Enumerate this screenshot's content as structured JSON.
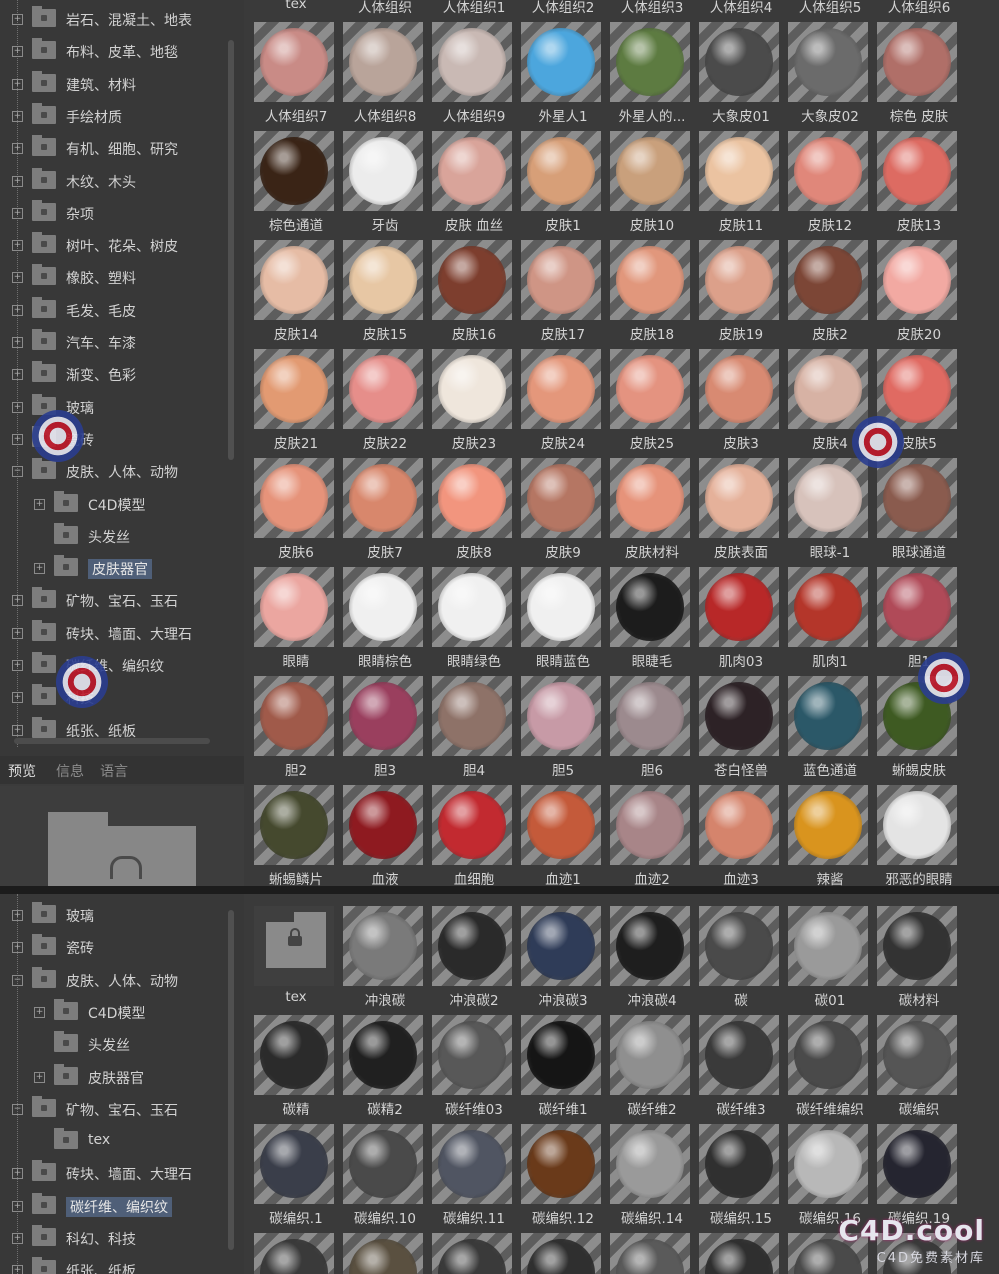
{
  "top": {
    "tree": [
      {
        "label": "岩石、混凝土、地表",
        "type": "folder",
        "expand": "plus",
        "depth": 0
      },
      {
        "label": "布料、皮革、地毯",
        "type": "folder",
        "expand": "plus",
        "depth": 0
      },
      {
        "label": "建筑、材料",
        "type": "folder",
        "expand": "plus",
        "depth": 0
      },
      {
        "label": "手绘材质",
        "type": "folder",
        "expand": "plus",
        "depth": 0
      },
      {
        "label": "有机、细胞、研究",
        "type": "folder",
        "expand": "plus",
        "depth": 0
      },
      {
        "label": "木纹、木头",
        "type": "folder",
        "expand": "plus",
        "depth": 0
      },
      {
        "label": "杂项",
        "type": "folder",
        "expand": "plus",
        "depth": 0
      },
      {
        "label": "树叶、花朵、树皮",
        "type": "folder",
        "expand": "plus",
        "depth": 0
      },
      {
        "label": "橡胶、塑料",
        "type": "folder",
        "expand": "plus",
        "depth": 0
      },
      {
        "label": "毛发、毛皮",
        "type": "folder",
        "expand": "plus",
        "depth": 0
      },
      {
        "label": "汽车、车漆",
        "type": "folder",
        "expand": "plus",
        "depth": 0
      },
      {
        "label": "渐变、色彩",
        "type": "folder",
        "expand": "plus",
        "depth": 0
      },
      {
        "label": "玻璃",
        "type": "folder",
        "expand": "plus",
        "depth": 0
      },
      {
        "label": "瓷砖",
        "type": "folder",
        "expand": "plus",
        "depth": 0
      },
      {
        "label": "皮肤、人体、动物",
        "type": "folder",
        "expand": "minus",
        "depth": 0
      },
      {
        "label": "C4D模型",
        "type": "folder",
        "expand": "plus",
        "depth": 1
      },
      {
        "label": "头发丝",
        "type": "folder",
        "expand": "none",
        "depth": 1
      },
      {
        "label": "皮肤器官",
        "type": "folder",
        "expand": "plus",
        "depth": 1,
        "selected": true
      },
      {
        "label": "矿物、宝石、玉石",
        "type": "folder",
        "expand": "plus",
        "depth": 0
      },
      {
        "label": "砖块、墙面、大理石",
        "type": "folder",
        "expand": "plus",
        "depth": 0
      },
      {
        "label": "碳纤维、编织纹",
        "type": "folder",
        "expand": "plus",
        "depth": 0
      },
      {
        "label": "科技",
        "type": "folder",
        "expand": "plus",
        "depth": 0
      },
      {
        "label": "纸张、纸板",
        "type": "folder",
        "expand": "plus",
        "depth": 0
      }
    ],
    "tabs": [
      "预览",
      "信息",
      "语言"
    ],
    "header_captions": [
      "tex",
      "人体组织",
      "人体组织1",
      "人体组织2",
      "人体组织3",
      "人体组织4",
      "人体组织5",
      "人体组织6"
    ],
    "materials": [
      {
        "name": "人体组织7",
        "c": "#c98b86"
      },
      {
        "name": "人体组织8",
        "c": "#b9a49a"
      },
      {
        "name": "人体组织9",
        "c": "#c9b9b4"
      },
      {
        "name": "外星人1",
        "c": "#4ca6dd"
      },
      {
        "name": "外星人的...",
        "c": "#5d7b41"
      },
      {
        "name": "大象皮01",
        "c": "#4b4b4b"
      },
      {
        "name": "大象皮02",
        "c": "#6b6b6b"
      },
      {
        "name": "棕色 皮肤",
        "c": "#b06f68"
      },
      {
        "name": "棕色通道",
        "c": "#3a2416"
      },
      {
        "name": "牙齿",
        "c": "#ececec"
      },
      {
        "name": "皮肤 血丝",
        "c": "#d9a49a"
      },
      {
        "name": "皮肤1",
        "c": "#d79f78"
      },
      {
        "name": "皮肤10",
        "c": "#c9a07c"
      },
      {
        "name": "皮肤11",
        "c": "#ebc3a1"
      },
      {
        "name": "皮肤12",
        "c": "#e0877a"
      },
      {
        "name": "皮肤13",
        "c": "#dd6b62"
      },
      {
        "name": "皮肤14",
        "c": "#e6bca5"
      },
      {
        "name": "皮肤15",
        "c": "#e7c7a4"
      },
      {
        "name": "皮肤16",
        "c": "#7d3e2e"
      },
      {
        "name": "皮肤17",
        "c": "#cf9585"
      },
      {
        "name": "皮肤18",
        "c": "#e1977c"
      },
      {
        "name": "皮肤19",
        "c": "#dca08a"
      },
      {
        "name": "皮肤2",
        "c": "#7c4636"
      },
      {
        "name": "皮肤20",
        "c": "#f2a9a2"
      },
      {
        "name": "皮肤21",
        "c": "#e29a72"
      },
      {
        "name": "皮肤22",
        "c": "#e68e8a"
      },
      {
        "name": "皮肤23",
        "c": "#efe6dc"
      },
      {
        "name": "皮肤24",
        "c": "#e4977b"
      },
      {
        "name": "皮肤25",
        "c": "#e49380"
      },
      {
        "name": "皮肤3",
        "c": "#d88a72"
      },
      {
        "name": "皮肤4",
        "c": "#d7b2a4"
      },
      {
        "name": "皮肤5",
        "c": "#e06a62"
      },
      {
        "name": "皮肤6",
        "c": "#e6937a"
      },
      {
        "name": "皮肤7",
        "c": "#d8876c"
      },
      {
        "name": "皮肤8",
        "c": "#f2957e"
      },
      {
        "name": "皮肤9",
        "c": "#b57663"
      },
      {
        "name": "皮肤材料",
        "c": "#e6937a"
      },
      {
        "name": "皮肤表面",
        "c": "#e5b19a"
      },
      {
        "name": "眼球-1",
        "c": "#d7c2bb"
      },
      {
        "name": "眼球通道",
        "c": "#8a5b4e"
      },
      {
        "name": "眼睛",
        "c": "#eba6a0"
      },
      {
        "name": "眼睛棕色",
        "c": "#f0f0f0"
      },
      {
        "name": "眼睛绿色",
        "c": "#f0f0f0"
      },
      {
        "name": "眼睛蓝色",
        "c": "#f0f0f0"
      },
      {
        "name": "眼睫毛",
        "c": "#1c1c1c"
      },
      {
        "name": "肌肉03",
        "c": "#b82828"
      },
      {
        "name": "肌肉1",
        "c": "#b4362a"
      },
      {
        "name": "胆1",
        "c": "#b04a58"
      },
      {
        "name": "胆2",
        "c": "#a05a4a"
      },
      {
        "name": "胆3",
        "c": "#9a3f5e"
      },
      {
        "name": "胆4",
        "c": "#8e7268"
      },
      {
        "name": "胆5",
        "c": "#c79aa6"
      },
      {
        "name": "胆6",
        "c": "#9c8a8e"
      },
      {
        "name": "苍白怪兽",
        "c": "#2d2226"
      },
      {
        "name": "蓝色通道",
        "c": "#2b5868"
      },
      {
        "name": "蜥蜴皮肤",
        "c": "#3e5a22"
      },
      {
        "name": "蜥蜴鳞片",
        "c": "#45492e"
      },
      {
        "name": "血液",
        "c": "#8e1a20"
      },
      {
        "name": "血细胞",
        "c": "#c22a30"
      },
      {
        "name": "血迹1",
        "c": "#c45a3a"
      },
      {
        "name": "血迹2",
        "c": "#a88588"
      },
      {
        "name": "血迹3",
        "c": "#d5846c"
      },
      {
        "name": "辣酱",
        "c": "#d9941e"
      },
      {
        "name": "邪恶的眼睛",
        "c": "#e4e4e4"
      }
    ]
  },
  "bottom": {
    "tree": [
      {
        "label": "玻璃",
        "expand": "plus",
        "depth": 0
      },
      {
        "label": "瓷砖",
        "expand": "plus",
        "depth": 0
      },
      {
        "label": "皮肤、人体、动物",
        "expand": "minus",
        "depth": 0
      },
      {
        "label": "C4D模型",
        "expand": "plus",
        "depth": 1
      },
      {
        "label": "头发丝",
        "expand": "none",
        "depth": 1
      },
      {
        "label": "皮肤器官",
        "expand": "plus",
        "depth": 1
      },
      {
        "label": "矿物、宝石、玉石",
        "expand": "minus",
        "depth": 0
      },
      {
        "label": "tex",
        "expand": "none",
        "depth": 1
      },
      {
        "label": "砖块、墙面、大理石",
        "expand": "plus",
        "depth": 0
      },
      {
        "label": "碳纤维、编织纹",
        "expand": "plus",
        "depth": 0,
        "selected": true
      },
      {
        "label": "科幻、科技",
        "expand": "plus",
        "depth": 0
      },
      {
        "label": "纸张、纸板",
        "expand": "plus",
        "depth": 0
      }
    ],
    "materials": [
      {
        "name": "tex",
        "c": "folder"
      },
      {
        "name": "冲浪碳",
        "c": "#7a7a7a"
      },
      {
        "name": "冲浪碳2",
        "c": "#2a2a2a"
      },
      {
        "name": "冲浪碳3",
        "c": "#2f3c58"
      },
      {
        "name": "冲浪碳4",
        "c": "#1e1e1e"
      },
      {
        "name": "碳",
        "c": "#4a4a4a"
      },
      {
        "name": "碳01",
        "c": "#9a9a9a"
      },
      {
        "name": "碳材料",
        "c": "#333333"
      },
      {
        "name": "碳精",
        "c": "#2b2b2b"
      },
      {
        "name": "碳精2",
        "c": "#202020"
      },
      {
        "name": "碳纤维03",
        "c": "#585858"
      },
      {
        "name": "碳纤维1",
        "c": "#151515"
      },
      {
        "name": "碳纤维2",
        "c": "#8f8f8f"
      },
      {
        "name": "碳纤维3",
        "c": "#3a3a3a"
      },
      {
        "name": "碳纤维编织",
        "c": "#4a4a4a"
      },
      {
        "name": "碳编织",
        "c": "#555555"
      },
      {
        "name": "碳编织.1",
        "c": "#3a3e4a"
      },
      {
        "name": "碳编织.10",
        "c": "#4a4a4a"
      },
      {
        "name": "碳编织.11",
        "c": "#505562"
      },
      {
        "name": "碳编织.12",
        "c": "#6a3a1a"
      },
      {
        "name": "碳编织.14",
        "c": "#9a9a9a"
      },
      {
        "name": "碳编织.15",
        "c": "#303030"
      },
      {
        "name": "碳编织.16",
        "c": "#b8b8b8"
      },
      {
        "name": "碳编织.19",
        "c": "#252530"
      },
      {
        "name": "",
        "c": "#3a3a3a"
      },
      {
        "name": "",
        "c": "#5a5040"
      },
      {
        "name": "",
        "c": "#3a3a3a"
      },
      {
        "name": "",
        "c": "#2f2f2f"
      },
      {
        "name": "",
        "c": "#5a5a5a"
      },
      {
        "name": "",
        "c": "#2f2f2f"
      },
      {
        "name": "",
        "c": "#4a4a4a"
      },
      {
        "name": "",
        "c": "#3a3a3a"
      }
    ]
  },
  "watermark": {
    "logo": "C4D.cool",
    "tagline": "C4D免费素材库"
  },
  "colors": {
    "selection": "#4f5f78",
    "stripe_light": "#8d8d8d",
    "stripe_dark": "#5d5d5d"
  }
}
